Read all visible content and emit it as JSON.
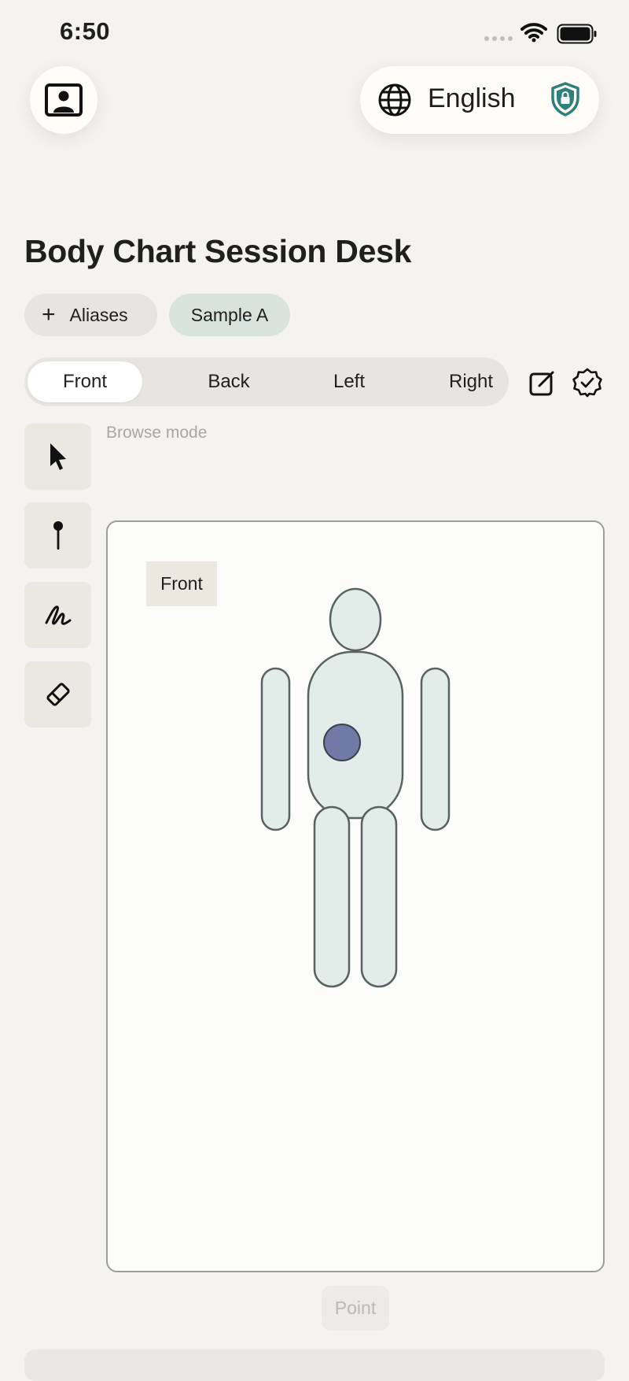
{
  "status_bar": {
    "time": "6:50"
  },
  "header": {
    "profile_icon": "portrait-frame-icon",
    "language": {
      "icon": "globe-icon",
      "label": "English"
    },
    "privacy_icon": "lock-shield-icon"
  },
  "title": "Body Chart Session Desk",
  "chips": {
    "add_symbol": "+",
    "aliases_label": "Aliases",
    "sample_label": "Sample A"
  },
  "view_tabs": [
    {
      "label": "Front",
      "active": true
    },
    {
      "label": "Back",
      "active": false
    },
    {
      "label": "Left",
      "active": false
    },
    {
      "label": "Right",
      "active": false
    }
  ],
  "toolbar_icons": {
    "edit": "edit-square-icon",
    "verify": "check-badge-icon"
  },
  "tools": [
    {
      "name": "select",
      "icon": "pointer-arrow-icon"
    },
    {
      "name": "pin",
      "icon": "pin-icon"
    },
    {
      "name": "draw",
      "icon": "scribble-icon"
    },
    {
      "name": "erase",
      "icon": "eraser-icon"
    }
  ],
  "mode_text": "Browse mode",
  "canvas": {
    "view_label": "Front",
    "figure_fill": "#e2edea",
    "figure_stroke": "#596262",
    "marker_color": "#6f7ba6"
  },
  "point_button": "Point",
  "colors": {
    "background": "#f5f3ef",
    "active_chip": "#d8e3de",
    "shield_accent": "#2f7f7c"
  }
}
